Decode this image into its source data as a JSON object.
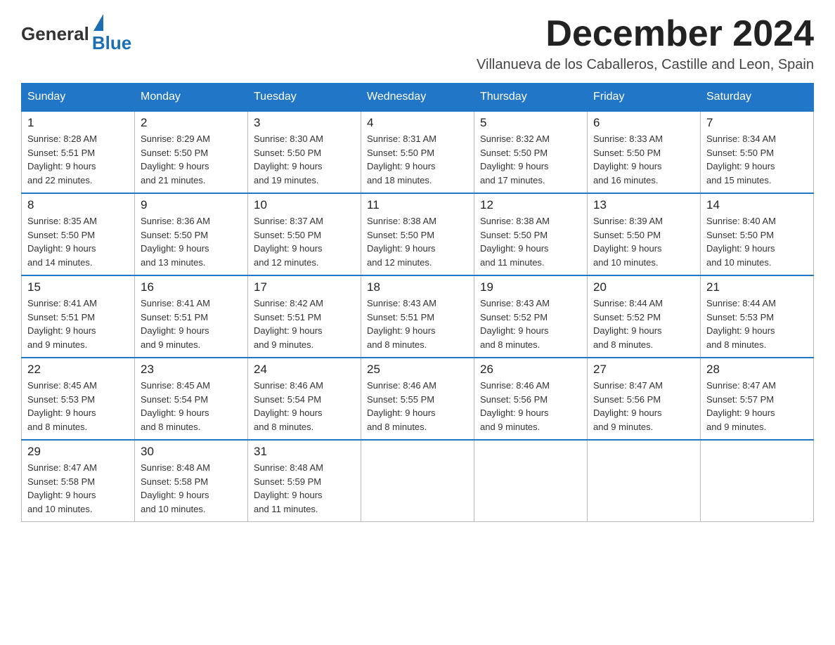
{
  "header": {
    "logo_general": "General",
    "logo_blue": "Blue",
    "month_title": "December 2024",
    "subtitle": "Villanueva de los Caballeros, Castille and Leon, Spain"
  },
  "weekdays": [
    "Sunday",
    "Monday",
    "Tuesday",
    "Wednesday",
    "Thursday",
    "Friday",
    "Saturday"
  ],
  "weeks": [
    [
      {
        "day": "1",
        "info": "Sunrise: 8:28 AM\nSunset: 5:51 PM\nDaylight: 9 hours\nand 22 minutes."
      },
      {
        "day": "2",
        "info": "Sunrise: 8:29 AM\nSunset: 5:50 PM\nDaylight: 9 hours\nand 21 minutes."
      },
      {
        "day": "3",
        "info": "Sunrise: 8:30 AM\nSunset: 5:50 PM\nDaylight: 9 hours\nand 19 minutes."
      },
      {
        "day": "4",
        "info": "Sunrise: 8:31 AM\nSunset: 5:50 PM\nDaylight: 9 hours\nand 18 minutes."
      },
      {
        "day": "5",
        "info": "Sunrise: 8:32 AM\nSunset: 5:50 PM\nDaylight: 9 hours\nand 17 minutes."
      },
      {
        "day": "6",
        "info": "Sunrise: 8:33 AM\nSunset: 5:50 PM\nDaylight: 9 hours\nand 16 minutes."
      },
      {
        "day": "7",
        "info": "Sunrise: 8:34 AM\nSunset: 5:50 PM\nDaylight: 9 hours\nand 15 minutes."
      }
    ],
    [
      {
        "day": "8",
        "info": "Sunrise: 8:35 AM\nSunset: 5:50 PM\nDaylight: 9 hours\nand 14 minutes."
      },
      {
        "day": "9",
        "info": "Sunrise: 8:36 AM\nSunset: 5:50 PM\nDaylight: 9 hours\nand 13 minutes."
      },
      {
        "day": "10",
        "info": "Sunrise: 8:37 AM\nSunset: 5:50 PM\nDaylight: 9 hours\nand 12 minutes."
      },
      {
        "day": "11",
        "info": "Sunrise: 8:38 AM\nSunset: 5:50 PM\nDaylight: 9 hours\nand 12 minutes."
      },
      {
        "day": "12",
        "info": "Sunrise: 8:38 AM\nSunset: 5:50 PM\nDaylight: 9 hours\nand 11 minutes."
      },
      {
        "day": "13",
        "info": "Sunrise: 8:39 AM\nSunset: 5:50 PM\nDaylight: 9 hours\nand 10 minutes."
      },
      {
        "day": "14",
        "info": "Sunrise: 8:40 AM\nSunset: 5:50 PM\nDaylight: 9 hours\nand 10 minutes."
      }
    ],
    [
      {
        "day": "15",
        "info": "Sunrise: 8:41 AM\nSunset: 5:51 PM\nDaylight: 9 hours\nand 9 minutes."
      },
      {
        "day": "16",
        "info": "Sunrise: 8:41 AM\nSunset: 5:51 PM\nDaylight: 9 hours\nand 9 minutes."
      },
      {
        "day": "17",
        "info": "Sunrise: 8:42 AM\nSunset: 5:51 PM\nDaylight: 9 hours\nand 9 minutes."
      },
      {
        "day": "18",
        "info": "Sunrise: 8:43 AM\nSunset: 5:51 PM\nDaylight: 9 hours\nand 8 minutes."
      },
      {
        "day": "19",
        "info": "Sunrise: 8:43 AM\nSunset: 5:52 PM\nDaylight: 9 hours\nand 8 minutes."
      },
      {
        "day": "20",
        "info": "Sunrise: 8:44 AM\nSunset: 5:52 PM\nDaylight: 9 hours\nand 8 minutes."
      },
      {
        "day": "21",
        "info": "Sunrise: 8:44 AM\nSunset: 5:53 PM\nDaylight: 9 hours\nand 8 minutes."
      }
    ],
    [
      {
        "day": "22",
        "info": "Sunrise: 8:45 AM\nSunset: 5:53 PM\nDaylight: 9 hours\nand 8 minutes."
      },
      {
        "day": "23",
        "info": "Sunrise: 8:45 AM\nSunset: 5:54 PM\nDaylight: 9 hours\nand 8 minutes."
      },
      {
        "day": "24",
        "info": "Sunrise: 8:46 AM\nSunset: 5:54 PM\nDaylight: 9 hours\nand 8 minutes."
      },
      {
        "day": "25",
        "info": "Sunrise: 8:46 AM\nSunset: 5:55 PM\nDaylight: 9 hours\nand 8 minutes."
      },
      {
        "day": "26",
        "info": "Sunrise: 8:46 AM\nSunset: 5:56 PM\nDaylight: 9 hours\nand 9 minutes."
      },
      {
        "day": "27",
        "info": "Sunrise: 8:47 AM\nSunset: 5:56 PM\nDaylight: 9 hours\nand 9 minutes."
      },
      {
        "day": "28",
        "info": "Sunrise: 8:47 AM\nSunset: 5:57 PM\nDaylight: 9 hours\nand 9 minutes."
      }
    ],
    [
      {
        "day": "29",
        "info": "Sunrise: 8:47 AM\nSunset: 5:58 PM\nDaylight: 9 hours\nand 10 minutes."
      },
      {
        "day": "30",
        "info": "Sunrise: 8:48 AM\nSunset: 5:58 PM\nDaylight: 9 hours\nand 10 minutes."
      },
      {
        "day": "31",
        "info": "Sunrise: 8:48 AM\nSunset: 5:59 PM\nDaylight: 9 hours\nand 11 minutes."
      },
      {
        "day": "",
        "info": ""
      },
      {
        "day": "",
        "info": ""
      },
      {
        "day": "",
        "info": ""
      },
      {
        "day": "",
        "info": ""
      }
    ]
  ]
}
